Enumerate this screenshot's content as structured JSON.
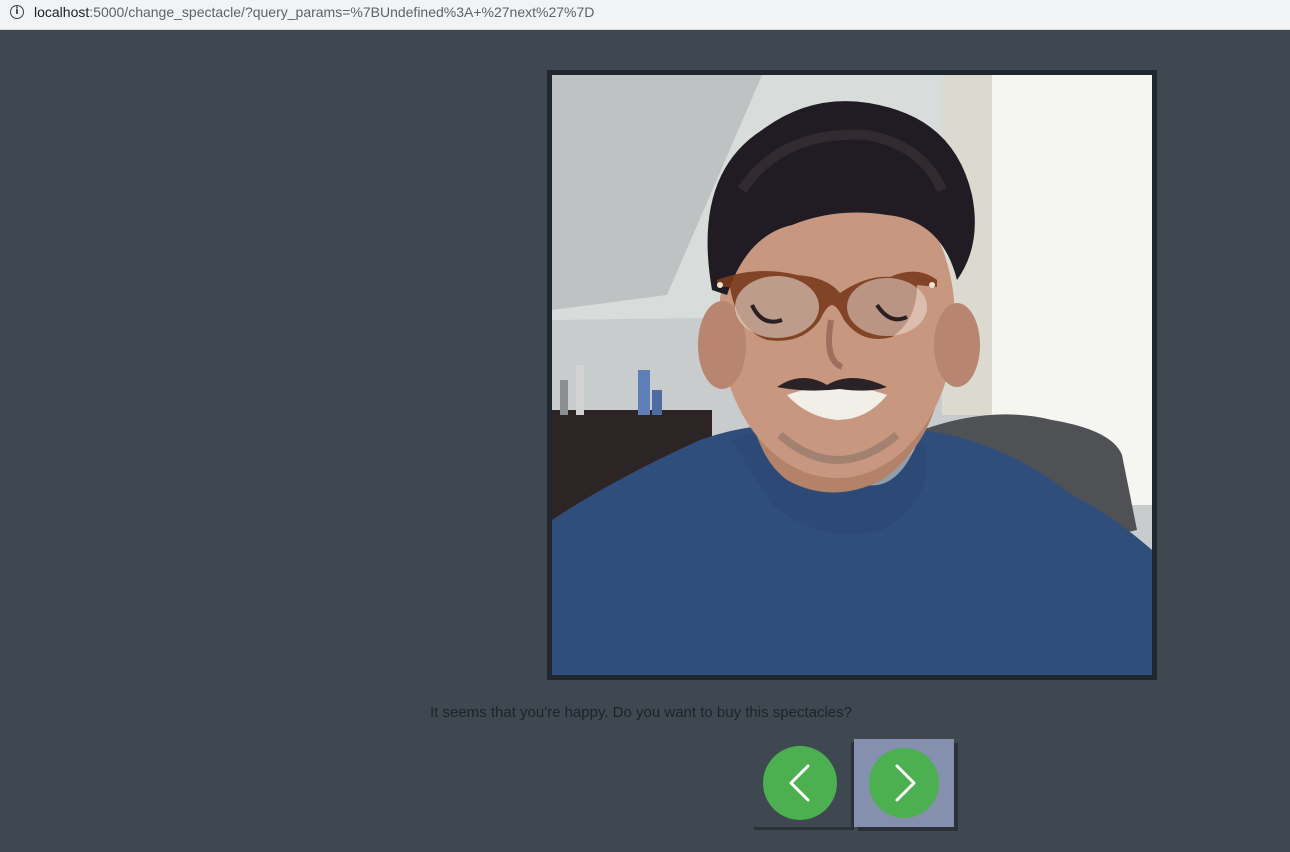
{
  "browser": {
    "url_host": "localhost",
    "url_rest": ":5000/change_spectacle/?query_params=%7BUndefined%3A+%27next%27%7D"
  },
  "page": {
    "message": "It seems that you're happy. Do you want to buy this spectacles?"
  },
  "icons": {
    "info": "info-icon",
    "previous": "chevron-left-icon",
    "next": "chevron-right-icon"
  },
  "colors": {
    "background": "#3f4750",
    "frame": "#20262d",
    "button_green": "#4caf50",
    "active_button": "#8490ae"
  }
}
